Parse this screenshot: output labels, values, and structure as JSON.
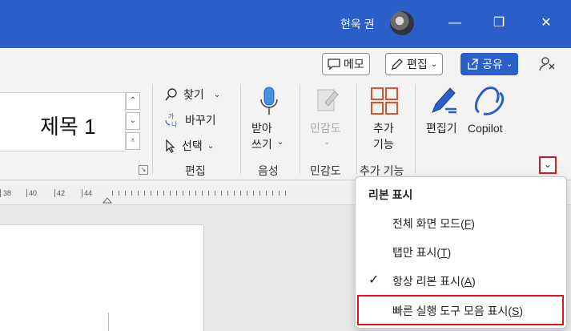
{
  "titlebar": {
    "user_name": "현욱 권",
    "minimize_glyph": "—",
    "restore_glyph": "❐",
    "close_glyph": "✕"
  },
  "toolbar": {
    "memo_label": "메모",
    "edit_mode_label": "편집",
    "share_label": "공유"
  },
  "styles": {
    "current_style": "제목 1"
  },
  "edit_group": {
    "find": "찾기",
    "replace": "바꾸기",
    "select": "선택",
    "label": "편집"
  },
  "voice_group": {
    "dictate_line1": "받아",
    "dictate_line2": "쓰기",
    "label": "음성"
  },
  "sensitivity_group": {
    "button": "민감도",
    "label": "민감도"
  },
  "addins_group": {
    "line1": "추가",
    "line2": "기능",
    "label": "추가 기능"
  },
  "ai_group": {
    "editor": "편집기",
    "copilot": "Copilot"
  },
  "ruler": {
    "labels": [
      "38",
      "40",
      "42",
      "44"
    ]
  },
  "ribbon_menu": {
    "header": "리본 표시",
    "items": [
      {
        "text": "전체 화면 모드",
        "key": "F",
        "checked": false
      },
      {
        "text": "탭만 표시",
        "key": "T",
        "checked": false
      },
      {
        "text": "항상 리본 표시",
        "key": "A",
        "checked": true
      },
      {
        "text": "빠른 실행 도구 모음 표시",
        "key": "S",
        "checked": false
      }
    ]
  },
  "colors": {
    "titlebar": "#2b5fc7",
    "highlight": "#e0151b"
  }
}
